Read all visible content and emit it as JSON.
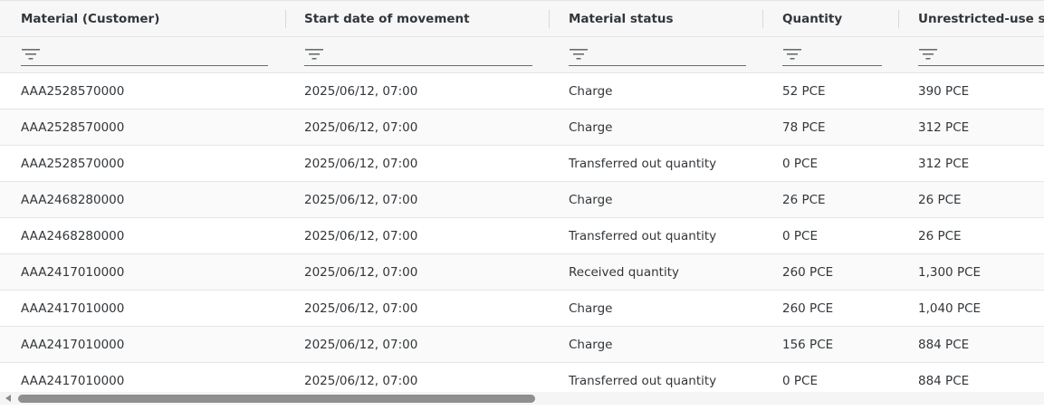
{
  "columns": [
    {
      "label": "Material (Customer)"
    },
    {
      "label": "Start date of movement"
    },
    {
      "label": "Material status"
    },
    {
      "label": "Quantity"
    },
    {
      "label": "Unrestricted-use sto"
    }
  ],
  "rows": [
    {
      "material": "AAA2528570000",
      "start": "2025/06/12, 07:00",
      "status": "Charge",
      "quantity": "52 PCE",
      "unrestricted": "390 PCE"
    },
    {
      "material": "AAA2528570000",
      "start": "2025/06/12, 07:00",
      "status": "Charge",
      "quantity": "78 PCE",
      "unrestricted": "312 PCE"
    },
    {
      "material": "AAA2528570000",
      "start": "2025/06/12, 07:00",
      "status": "Transferred out quantity",
      "quantity": "0 PCE",
      "unrestricted": "312 PCE"
    },
    {
      "material": "AAA2468280000",
      "start": "2025/06/12, 07:00",
      "status": "Charge",
      "quantity": "26 PCE",
      "unrestricted": "26 PCE"
    },
    {
      "material": "AAA2468280000",
      "start": "2025/06/12, 07:00",
      "status": "Transferred out quantity",
      "quantity": "0 PCE",
      "unrestricted": "26 PCE"
    },
    {
      "material": "AAA2417010000",
      "start": "2025/06/12, 07:00",
      "status": "Received quantity",
      "quantity": "260 PCE",
      "unrestricted": "1,300 PCE"
    },
    {
      "material": "AAA2417010000",
      "start": "2025/06/12, 07:00",
      "status": "Charge",
      "quantity": "260 PCE",
      "unrestricted": "1,040 PCE"
    },
    {
      "material": "AAA2417010000",
      "start": "2025/06/12, 07:00",
      "status": "Charge",
      "quantity": "156 PCE",
      "unrestricted": "884 PCE"
    },
    {
      "material": "AAA2417010000",
      "start": "2025/06/12, 07:00",
      "status": "Transferred out quantity",
      "quantity": "0 PCE",
      "unrestricted": "884 PCE"
    }
  ],
  "icons": {
    "filter": "filter-icon",
    "scroll_left": "chevron-left-icon"
  },
  "colors": {
    "header_bg": "#f7f7f7",
    "text": "#32363a",
    "border": "#e5e5e5",
    "scroll_thumb": "#8f8f8f"
  }
}
